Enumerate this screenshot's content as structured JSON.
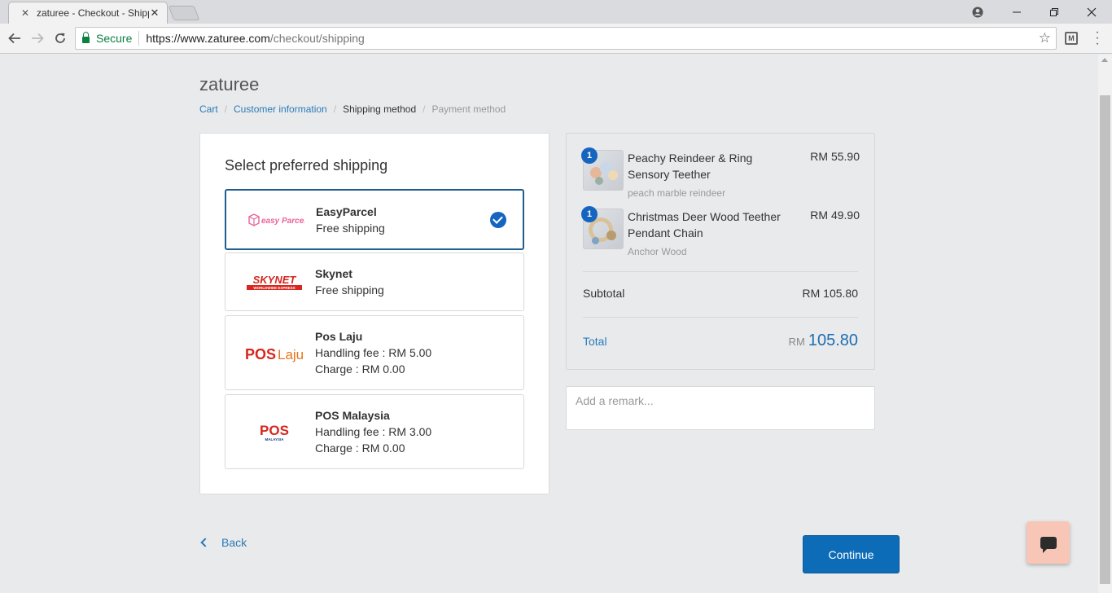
{
  "browser": {
    "tab_title": "zaturee - Checkout - Shipping method",
    "secure_label": "Secure",
    "url_host": "https://www.zaturee.com",
    "url_path": "/checkout/shipping"
  },
  "page": {
    "brand": "zaturee",
    "breadcrumb": [
      {
        "label": "Cart"
      },
      {
        "label": "Customer information"
      },
      {
        "label": "Shipping method"
      },
      {
        "label": "Payment method"
      }
    ],
    "breadcrumb_separator": "/"
  },
  "shipping": {
    "title": "Select preferred shipping",
    "selected_index": 0,
    "options": [
      {
        "name": "EasyParcel",
        "line1": "Free shipping",
        "line2": "",
        "logo_text": "easy Parcel"
      },
      {
        "name": "Skynet",
        "line1": "Free shipping",
        "line2": "",
        "logo_text": "SKYNET",
        "logo_sub": "WORLDWIDE EXPRESS"
      },
      {
        "name": "Pos Laju",
        "line1": "Handling fee : RM 5.00",
        "line2": "Charge : RM 0.00",
        "logo_text_a": "POS",
        "logo_text_b": "Laju"
      },
      {
        "name": "POS Malaysia",
        "line1": "Handling fee : RM 3.00",
        "line2": "Charge : RM 0.00",
        "logo_text": "POS",
        "logo_sub": "MALAYSIA"
      }
    ]
  },
  "summary": {
    "items": [
      {
        "qty": "1",
        "name": "Peachy Reindeer & Ring Sensory Teether",
        "variant": "peach marble reindeer",
        "price": "RM 55.90"
      },
      {
        "qty": "1",
        "name": "Christmas Deer Wood Teether Pendant Chain",
        "variant": "Anchor Wood",
        "price": "RM 49.90"
      }
    ],
    "subtotal_label": "Subtotal",
    "subtotal_value": "RM 105.80",
    "total_label": "Total",
    "total_currency": "RM",
    "total_value": "105.80"
  },
  "remark": {
    "placeholder": "Add a remark..."
  },
  "actions": {
    "back_label": "Back",
    "continue_label": "Continue"
  },
  "colors": {
    "accent": "#0d6cb7",
    "link": "#2a7bb8",
    "chat_button": "#f8c6b6"
  }
}
